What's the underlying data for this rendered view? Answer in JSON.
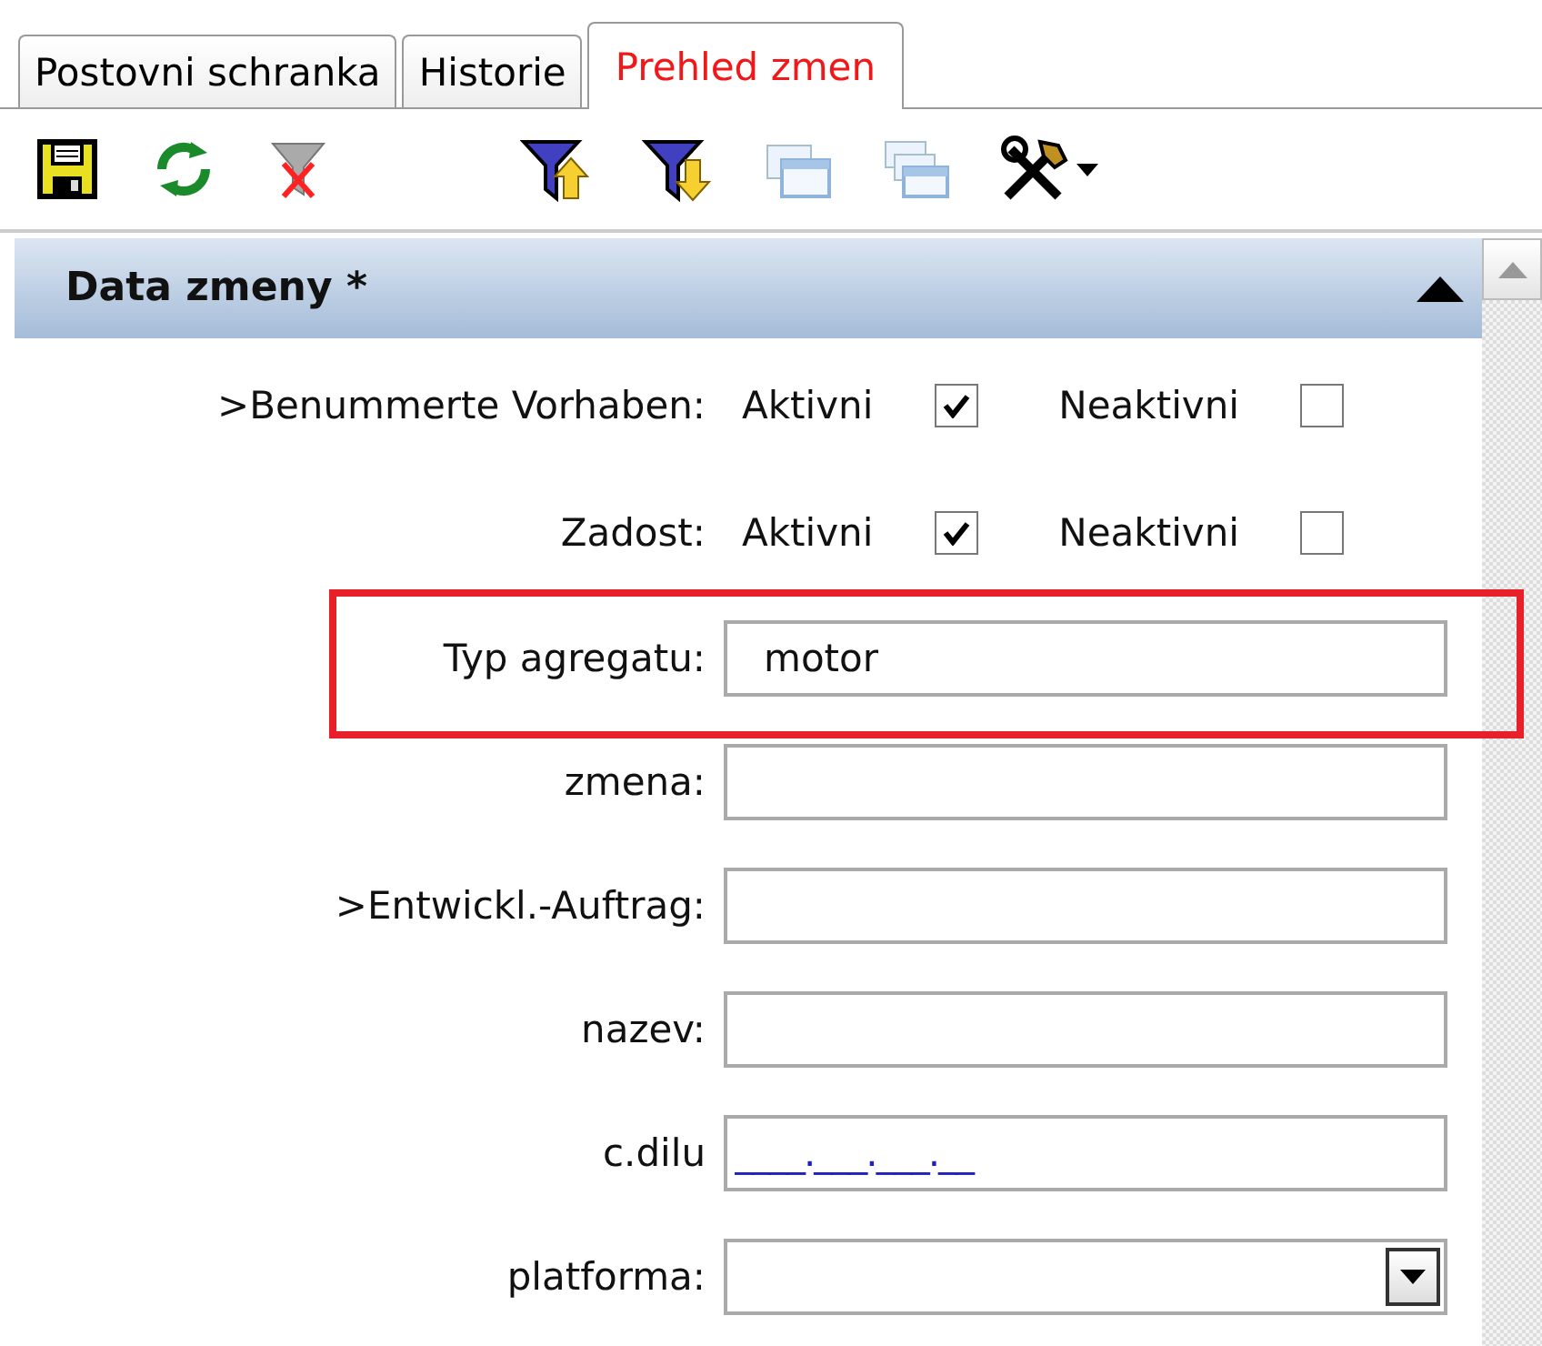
{
  "tabs": [
    {
      "label": "Postovni schranka",
      "selected": false
    },
    {
      "label": "Historie",
      "selected": false
    },
    {
      "label": "Prehled zmen",
      "selected": true
    }
  ],
  "toolbar": [
    {
      "kind": "save",
      "disabled": false
    },
    {
      "kind": "refresh",
      "disabled": false
    },
    {
      "kind": "filter-clear",
      "disabled": false
    },
    {
      "kind": "gap"
    },
    {
      "kind": "filter-up",
      "disabled": false
    },
    {
      "kind": "filter-down",
      "disabled": false
    },
    {
      "kind": "window",
      "disabled": true
    },
    {
      "kind": "windows",
      "disabled": true
    },
    {
      "kind": "tools",
      "disabled": false
    }
  ],
  "section": {
    "title": "Data zmeny *",
    "expanded": true
  },
  "rows": [
    {
      "kind": "checks",
      "label": ">Benummerte Vorhaben:",
      "options": [
        {
          "label": "Aktivni",
          "checked": true
        },
        {
          "label": "Neaktivni",
          "checked": false
        }
      ]
    },
    {
      "kind": "checks",
      "label": "Zadost:",
      "options": [
        {
          "label": "Aktivni",
          "checked": true
        },
        {
          "label": "Neaktivni",
          "checked": false
        }
      ]
    },
    {
      "kind": "text",
      "label": "Typ agregatu:",
      "value": "motor",
      "highlighted": true
    },
    {
      "kind": "text",
      "label": "zmena:",
      "highlighted": false
    },
    {
      "kind": "text",
      "label": ">Entwickl.-Auftrag:",
      "highlighted": false
    },
    {
      "kind": "text",
      "label": "nazev:",
      "highlighted": false
    },
    {
      "kind": "masked",
      "label": "c.dilu",
      "value": "____.___.___.__",
      "highlighted": false
    },
    {
      "kind": "dropdown",
      "label": "platforma:",
      "highlighted": false
    }
  ]
}
